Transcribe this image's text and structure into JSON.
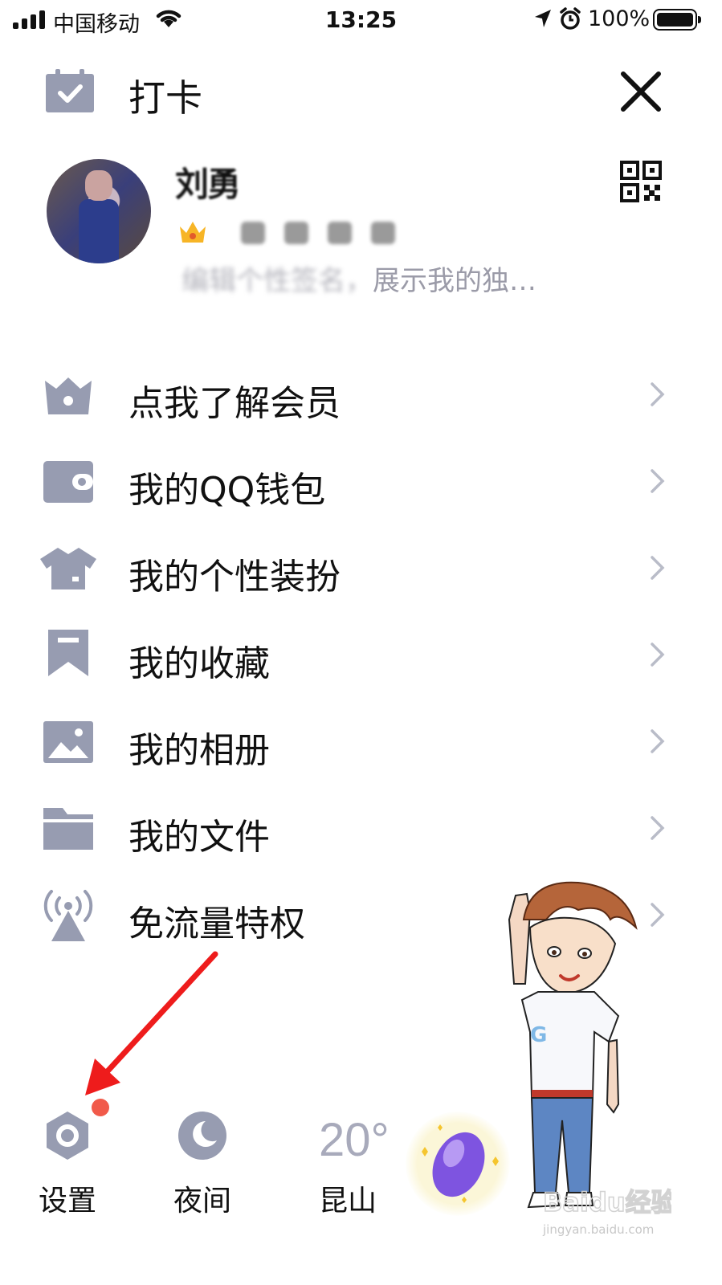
{
  "status_bar": {
    "carrier": "中国移动",
    "time": "13:25",
    "battery": "100%"
  },
  "header": {
    "checkin_label": "打卡",
    "close_icon": "close-icon"
  },
  "profile": {
    "nickname": "刘勇",
    "signature_blurred": "编辑个性签名，",
    "signature_visible": "展示我的独…",
    "qr_icon": "qr-code-icon"
  },
  "menu": {
    "items": [
      {
        "label": "点我了解会员",
        "icon": "vip-crown-icon"
      },
      {
        "label": "我的QQ钱包",
        "icon": "wallet-icon"
      },
      {
        "label": "我的个性装扮",
        "icon": "shirt-icon"
      },
      {
        "label": "我的收藏",
        "icon": "bookmark-icon"
      },
      {
        "label": "我的相册",
        "icon": "album-icon"
      },
      {
        "label": "我的文件",
        "icon": "folder-icon"
      },
      {
        "label": "免流量特权",
        "icon": "broadcast-icon"
      }
    ]
  },
  "bottom": {
    "settings_label": "设置",
    "night_label": "夜间",
    "temperature": "20°",
    "city": "昆山"
  },
  "watermark": {
    "text": "Baidu经验",
    "sub": "jingyan.baidu.com"
  },
  "colors": {
    "icon_gray": "#979cb1",
    "accent_red": "#f15a4a",
    "annotation_arrow": "#ee1c1c"
  }
}
